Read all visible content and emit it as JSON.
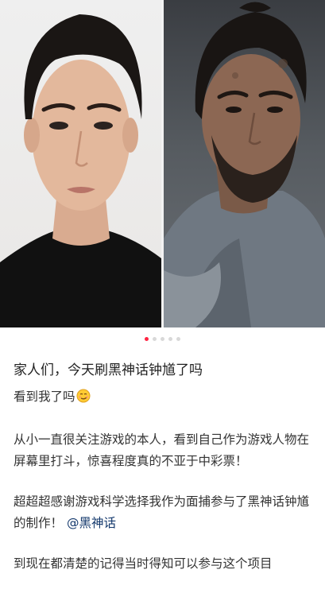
{
  "gallery": {
    "images": [
      "portrait-photo",
      "character-still"
    ],
    "page_count": 5,
    "active_index": 0
  },
  "note": {
    "title": "家人们，今天刷黑神话钟馗了吗",
    "line1": "看到我了吗",
    "line1_emoji": "smirking-face-emoji",
    "para2": "从小一直很关注游戏的本人，看到自己作为游戏人物在屏幕里打斗，惊喜程度真的不亚于中彩票！",
    "para3_text": "超超超感谢游戏科学选择我作为面捕参与了黑神话钟馗的制作！",
    "para3_mention": "@黑神话",
    "para4": "到现在都清楚的记得当时得知可以参与这个项目"
  },
  "colors": {
    "accent": "#ff2442",
    "mention": "#13386c"
  }
}
